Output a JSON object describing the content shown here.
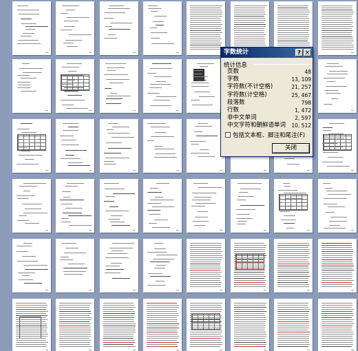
{
  "dialog": {
    "title": "字数统计",
    "help_label": "?",
    "close_label": "✕",
    "group_label": "统计信息",
    "stats": [
      {
        "label": "页数",
        "value": "48"
      },
      {
        "label": "字数",
        "value": "13, 109"
      },
      {
        "label": "字符数(不计空格)",
        "value": "21, 257"
      },
      {
        "label": "字符数(计空格)",
        "value": "25, 467"
      },
      {
        "label": "段落数",
        "value": "798"
      },
      {
        "label": "行数",
        "value": "1, 472"
      },
      {
        "label": "非中文单词",
        "value": "2, 597"
      },
      {
        "label": "中文字符和朝鲜语单词",
        "value": "10, 512"
      }
    ],
    "checkbox_label": "包括文本框、脚注和尾注(F)",
    "button_label": "关闭"
  },
  "colors": {
    "background": "#8c9cb8",
    "title_bar": "#0a246a",
    "dialog_bg": "#ece9d8"
  }
}
